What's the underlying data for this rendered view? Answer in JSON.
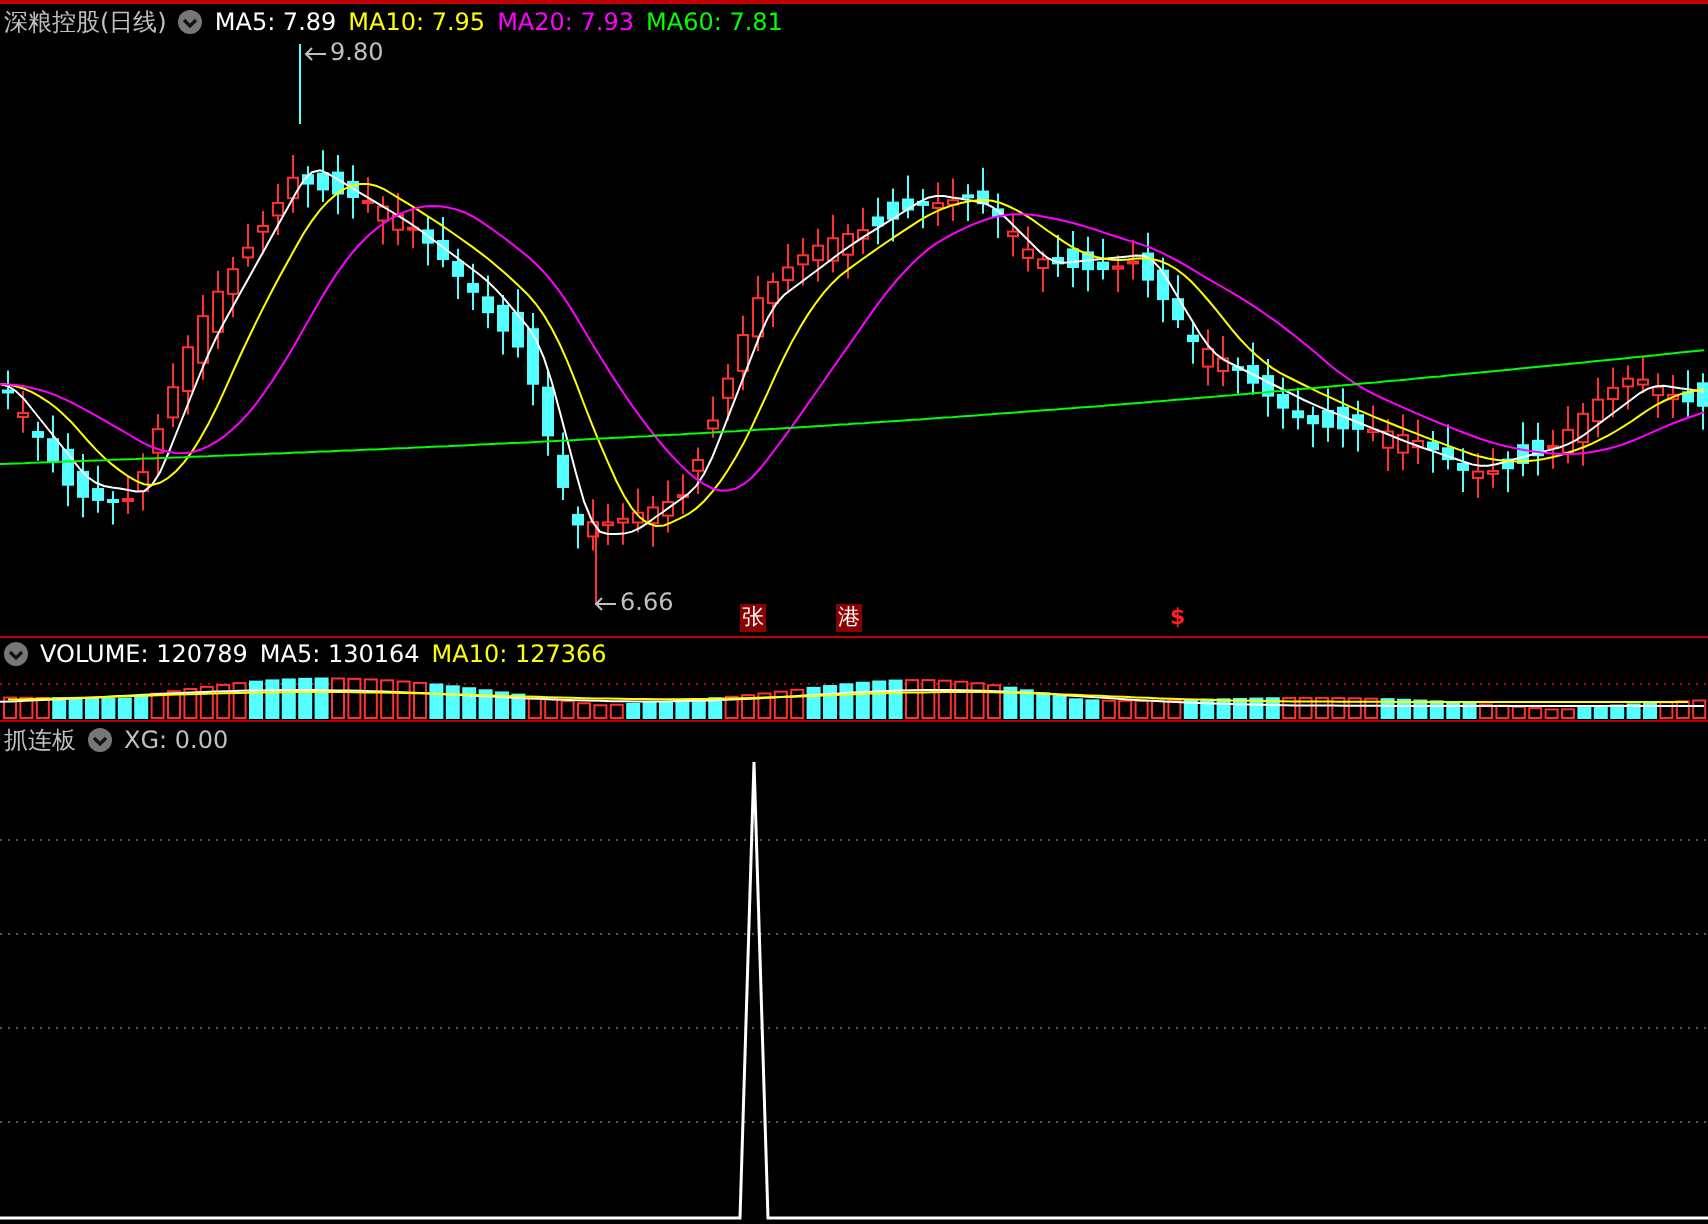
{
  "main_panel": {
    "title": "深粮控股(日线)",
    "indicators": [
      {
        "label": "MA5: 7.89",
        "color": "#ffffff"
      },
      {
        "label": "MA10: 7.95",
        "color": "#ffff00"
      },
      {
        "label": "MA20: 7.93",
        "color": "#ff00ff"
      },
      {
        "label": "MA60: 7.81",
        "color": "#00ff00"
      }
    ],
    "high_label": "9.80",
    "low_label": "6.66",
    "markers": [
      {
        "text": "张",
        "kind": "badge"
      },
      {
        "text": "港",
        "kind": "badge"
      },
      {
        "text": "$",
        "kind": "symbol"
      }
    ]
  },
  "volume_panel": {
    "indicators": [
      {
        "label": "VOLUME: 120789",
        "color": "#ffffff"
      },
      {
        "label": "MA5: 130164",
        "color": "#ffffff"
      },
      {
        "label": "MA10: 127366",
        "color": "#ffff00"
      }
    ]
  },
  "indicator_panel": {
    "title": "抓连板",
    "indicators": [
      {
        "label": "XG: 0.00",
        "color": "#c0c0c0"
      }
    ]
  }
}
